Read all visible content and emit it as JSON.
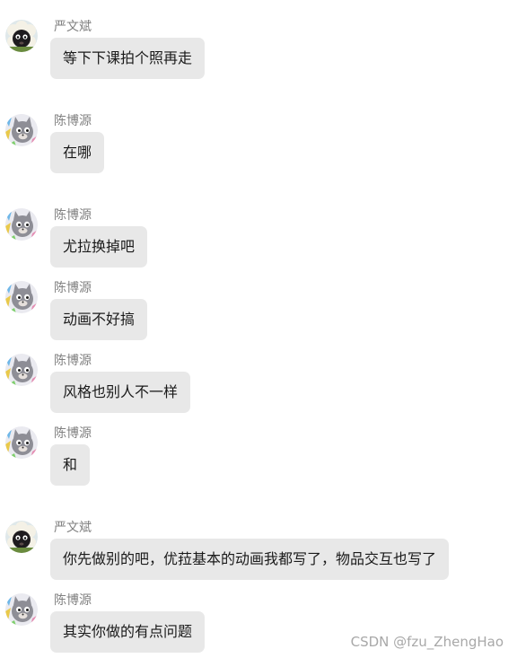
{
  "messages": [
    {
      "sender": "严文斌",
      "text": "等下下课拍个照再走",
      "avatar": "sheep-avatar"
    },
    {
      "sender": "陈博源",
      "text": "在哪",
      "avatar": "cat-avatar"
    },
    {
      "sender": "陈博源",
      "text": "尤拉换掉吧",
      "avatar": "cat-avatar"
    },
    {
      "sender": "陈博源",
      "text": "动画不好搞",
      "avatar": "cat-avatar"
    },
    {
      "sender": "陈博源",
      "text": "风格也别人不一样",
      "avatar": "cat-avatar"
    },
    {
      "sender": "陈博源",
      "text": "和",
      "avatar": "cat-avatar"
    },
    {
      "sender": "严文斌",
      "text": "你先做别的吧，优菈基本的动画我都写了，物品交互也写了",
      "avatar": "sheep-avatar"
    },
    {
      "sender": "陈博源",
      "text": "其实你做的有点问题",
      "avatar": "cat-avatar"
    }
  ],
  "watermark": "CSDN @fzu_ZhengHao",
  "colors": {
    "bubble": "#e8e8e8",
    "sender_name": "#808080",
    "text": "#1a1a1a"
  }
}
